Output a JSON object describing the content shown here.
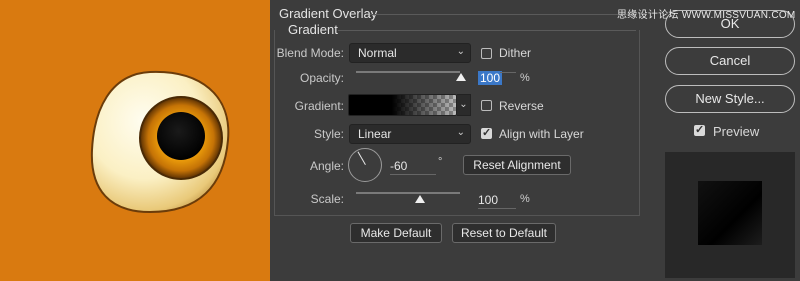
{
  "watermark": "思缘设计论坛 WWW.MISSVUAN.COM",
  "panel": {
    "title": "Gradient Overlay",
    "section": "Gradient"
  },
  "fields": {
    "blend_mode": {
      "label": "Blend Mode:",
      "value": "Normal"
    },
    "dither": {
      "label": "Dither",
      "checked": false
    },
    "opacity": {
      "label": "Opacity:",
      "value": "100",
      "unit": "%",
      "level": 1.0
    },
    "gradient": {
      "label": "Gradient:"
    },
    "reverse": {
      "label": "Reverse",
      "checked": false
    },
    "style": {
      "label": "Style:",
      "value": "Linear"
    },
    "align_with_layer": {
      "label": "Align with Layer",
      "checked": true
    },
    "angle": {
      "label": "Angle:",
      "value": "-60",
      "unit": "°"
    },
    "scale": {
      "label": "Scale:",
      "value": "100",
      "unit": "%",
      "level": 0.5
    }
  },
  "buttons": {
    "reset_alignment": "Reset Alignment",
    "make_default": "Make Default",
    "reset_to_default": "Reset to Default"
  },
  "sidebar": {
    "ok": "OK",
    "cancel": "Cancel",
    "new_style": "New Style...",
    "preview_label": "Preview",
    "preview_checked": true
  },
  "icons": {
    "dropdown": "chevron-down-icon",
    "check": "checkmark-icon",
    "angle_dial": "angle-dial-icon",
    "slider": "slider-thumb-icon"
  },
  "colors": {
    "canvas_bg": "#d97a10",
    "dialog_bg": "#3c3c3c",
    "selection": "#3b78c8"
  }
}
